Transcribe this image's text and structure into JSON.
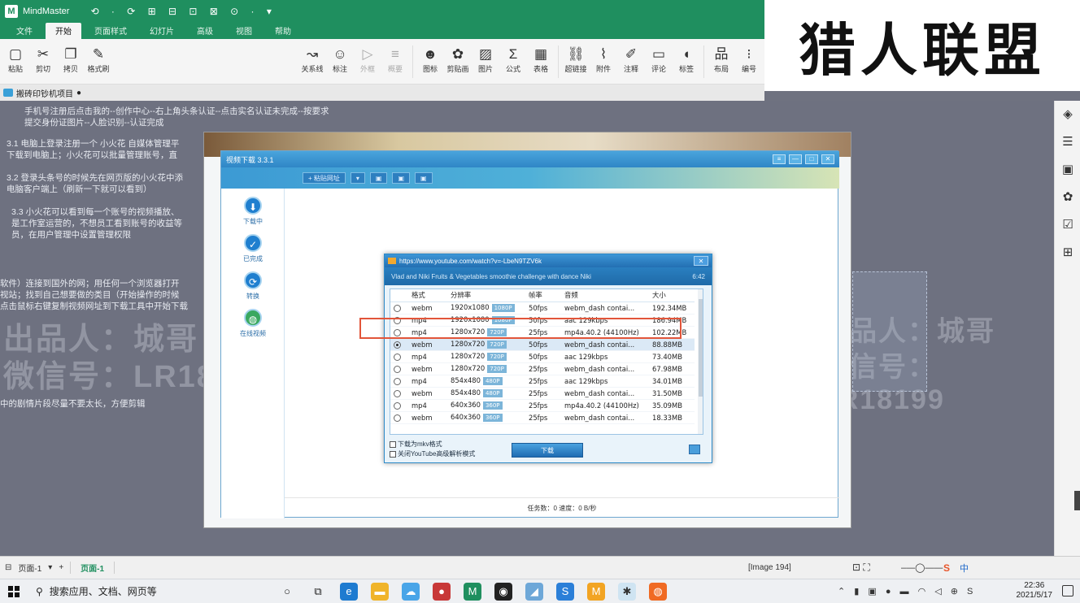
{
  "app": {
    "name": "MindMaster",
    "quick_access": "⟲ · ⟳ ⊞ ⊟ ⊡ ⊠ ⊙ · ▾"
  },
  "menu": [
    "文件",
    "开始",
    "页面样式",
    "幻灯片",
    "高级",
    "视图",
    "帮助"
  ],
  "brand": "猎人联盟",
  "ribbon": {
    "left": [
      {
        "label": "粘贴",
        "icon": "clipboard-icon",
        "glyph": "▢"
      },
      {
        "label": "剪切",
        "icon": "scissors-icon",
        "glyph": "✂"
      },
      {
        "label": "拷贝",
        "icon": "copy-icon",
        "glyph": "❐"
      },
      {
        "label": "格式刷",
        "icon": "brush-icon",
        "glyph": "✎"
      }
    ],
    "right": [
      {
        "label": "关系线",
        "icon": "relation-icon",
        "glyph": "↝"
      },
      {
        "label": "标注",
        "icon": "callout-icon",
        "glyph": "☺"
      },
      {
        "label": "外框",
        "icon": "frame-icon",
        "glyph": "▷",
        "disabled": true
      },
      {
        "label": "概要",
        "icon": "summary-icon",
        "glyph": "≡",
        "disabled": true
      },
      {
        "label": "图标",
        "icon": "emoji-icon",
        "glyph": "☻"
      },
      {
        "label": "剪贴画",
        "icon": "clipart-icon",
        "glyph": "✿"
      },
      {
        "label": "图片",
        "icon": "image-icon",
        "glyph": "▨"
      },
      {
        "label": "公式",
        "icon": "formula-icon",
        "glyph": "Σ"
      },
      {
        "label": "表格",
        "icon": "table-icon",
        "glyph": "▦"
      },
      {
        "label": "超链接",
        "icon": "hyperlink-icon",
        "glyph": "⛓"
      },
      {
        "label": "附件",
        "icon": "attachment-icon",
        "glyph": "⌇"
      },
      {
        "label": "注释",
        "icon": "note-icon",
        "glyph": "✐"
      },
      {
        "label": "评论",
        "icon": "comment-icon",
        "glyph": "▭"
      },
      {
        "label": "标签",
        "icon": "tag-icon",
        "glyph": "◖"
      },
      {
        "label": "布局",
        "icon": "layout-icon",
        "glyph": "品"
      },
      {
        "label": "编号",
        "icon": "numbering-icon",
        "glyph": "⁝"
      }
    ]
  },
  "doc_tab": "搬砖印钞机项目",
  "notes": [
    "手机号注册后点击我的--创作中心--右上角头条认证--点击实名认证未完成--按要求",
    "提交身份证图片--人脸识别--认证完成",
    "3.1 电脑上登录注册一个 小火花 自媒体管理平",
    "下载到电脑上；小火花可以批量管理账号，直",
    "3.2 登录头条号的时候先在网页版的小火花中添",
    "电脑客户端上（刷新一下就可以看到）",
    "3.3 小火花可以看到每一个账号的视频播放、",
    "是工作室运营的，不想员工看到账号的收益等",
    "员，在用户管理中设置管理权限",
    "软件）连接到国外的网；用任何一个浏览器打开",
    "视站；找到自己想要做的类目（开始操作的时候",
    "点击鼠标右键复制视频网址到下载工具中开始下载",
    "中的剧情片段尽量不要太长，方便剪辑"
  ],
  "watermark": {
    "line1": "出品人：城哥",
    "line2": "微信号：LR18199"
  },
  "downloader": {
    "title": "视频下载 3.3.1",
    "toolbar": [
      "+ 粘贴网址",
      "▾",
      "▣",
      "▣",
      "▣"
    ],
    "side": [
      {
        "label": "下载中",
        "icon": "download-icon",
        "glyph": "⬇"
      },
      {
        "label": "已完成",
        "icon": "check-icon",
        "glyph": "✓"
      },
      {
        "label": "转换",
        "icon": "convert-icon",
        "glyph": "⟳"
      },
      {
        "label": "在线视频",
        "icon": "globe-icon",
        "glyph": "◍"
      }
    ],
    "status": "任务数：0  速度：0 B/秒"
  },
  "format_dialog": {
    "url": "https://www.youtube.com/watch?v=-LbeN9TZV6k",
    "video_title": "Vlad and Niki Fruits & Vegetables smoothie challenge with dance Niki",
    "duration": "6:42",
    "columns": [
      "格式",
      "分辨率",
      "帧率",
      "音频",
      "大小"
    ],
    "rows": [
      {
        "fmt": "webm",
        "res": "1920x1080",
        "q": "1080P",
        "fps": "50fps",
        "audio": "webm_dash contai...",
        "size": "192.34MB"
      },
      {
        "fmt": "mp4",
        "res": "1920x1080",
        "q": "1080P",
        "fps": "50fps",
        "audio": "aac 129kbps",
        "size": "186.94MB"
      },
      {
        "fmt": "mp4",
        "res": "1280x720",
        "q": "720P",
        "fps": "25fps",
        "audio": "mp4a.40.2 (44100Hz)",
        "size": "102.22MB"
      },
      {
        "fmt": "webm",
        "res": "1280x720",
        "q": "720P",
        "fps": "50fps",
        "audio": "webm_dash contai...",
        "size": "88.88MB"
      },
      {
        "fmt": "mp4",
        "res": "1280x720",
        "q": "720P",
        "fps": "50fps",
        "audio": "aac 129kbps",
        "size": "73.40MB"
      },
      {
        "fmt": "webm",
        "res": "1280x720",
        "q": "720P",
        "fps": "25fps",
        "audio": "webm_dash contai...",
        "size": "67.98MB"
      },
      {
        "fmt": "mp4",
        "res": "854x480",
        "q": "480P",
        "fps": "25fps",
        "audio": "aac 129kbps",
        "size": "34.01MB"
      },
      {
        "fmt": "webm",
        "res": "854x480",
        "q": "480P",
        "fps": "25fps",
        "audio": "webm_dash contai...",
        "size": "31.50MB"
      },
      {
        "fmt": "mp4",
        "res": "640x360",
        "q": "360P",
        "fps": "25fps",
        "audio": "mp4a.40.2 (44100Hz)",
        "size": "35.09MB"
      },
      {
        "fmt": "webm",
        "res": "640x360",
        "q": "360P",
        "fps": "25fps",
        "audio": "webm_dash contai...",
        "size": "18.33MB"
      }
    ],
    "selected_row": 3,
    "opt1": "下载为mkv格式",
    "opt2": "关闭YouTube高级解析模式",
    "download_btn": "下载"
  },
  "pagebar": {
    "page_select": "页面-1",
    "add": "+",
    "current_page": "页面-1",
    "image_label": "[Image 194]"
  },
  "taskbar": {
    "search": "搜索应用、文档、网页等",
    "time": "22:36",
    "date": "2021/5/17",
    "tray_lang": "中"
  },
  "colors": {
    "app_green": "#1f8f5f",
    "highlight_red": "#e2553a",
    "dialog_blue": "#2d8ac8"
  }
}
